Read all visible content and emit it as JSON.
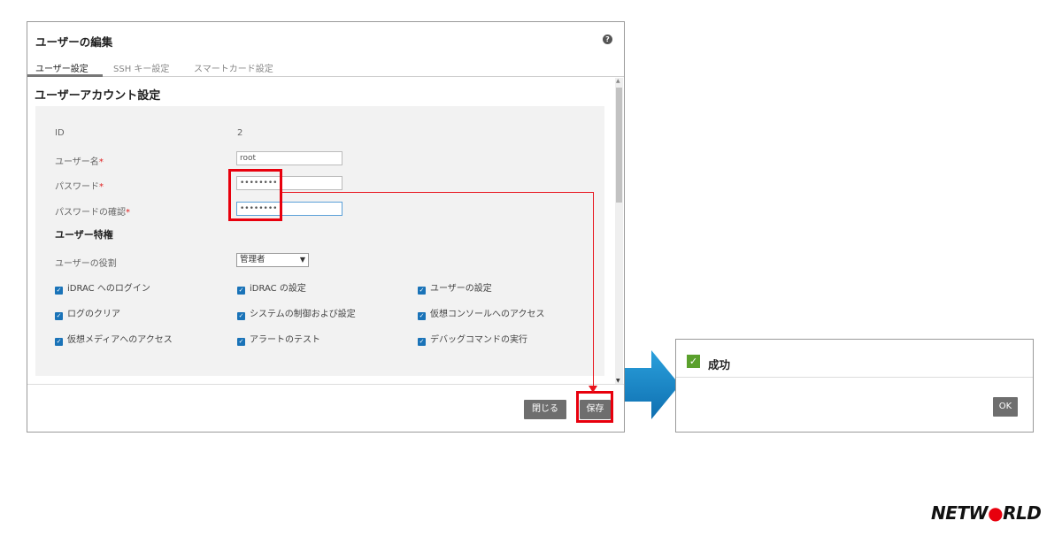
{
  "dialog": {
    "title": "ユーザーの編集",
    "help_icon": "?",
    "tabs": [
      "ユーザー設定",
      "SSH キー設定",
      "スマートカード設定"
    ],
    "section_title": "ユーザーアカウント設定",
    "fields": {
      "id_label": "ID",
      "id_value": "2",
      "username_label": "ユーザー名",
      "username_value": "root",
      "password_label": "パスワード",
      "password_value": "••••••••",
      "confirm_label": "パスワードの確認",
      "confirm_value": "••••••••",
      "required_mark": "*"
    },
    "privileges": {
      "title": "ユーザー特権",
      "role_label": "ユーザーの役割",
      "role_value": "管理者",
      "checkboxes": [
        "iDRAC へのログイン",
        "iDRAC の設定",
        "ユーザーの設定",
        "ログのクリア",
        "システムの制御および設定",
        "仮想コンソールへのアクセス",
        "仮想メディアへのアクセス",
        "アラートのテスト",
        "デバッグコマンドの実行"
      ]
    },
    "buttons": {
      "close": "閉じる",
      "save": "保存"
    }
  },
  "success": {
    "title": "成功",
    "ok": "OK"
  },
  "logo": "NETW●RLD",
  "colors": {
    "highlight": "#e8000d",
    "arrow": "#1e88c8",
    "checkbox": "#1a73b8",
    "success_check": "#5aa02c",
    "button": "#6e6e6e"
  },
  "icons": {
    "help": "help-icon",
    "check": "check-icon",
    "chevron": "chevron-down-icon",
    "arrow": "right-arrow-icon"
  }
}
